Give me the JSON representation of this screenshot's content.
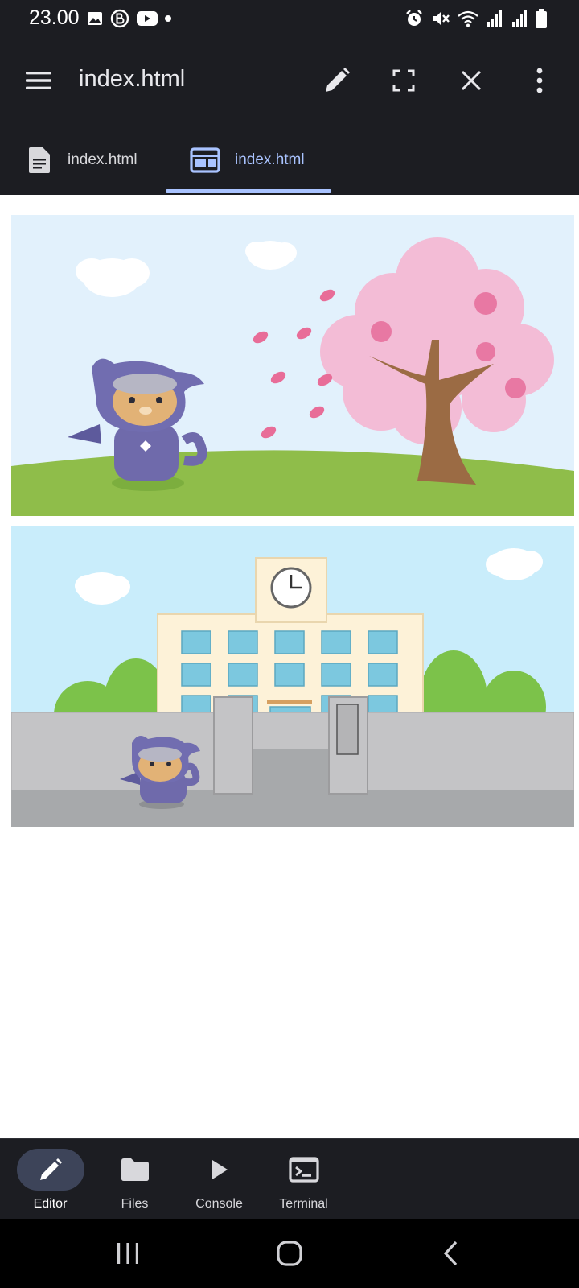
{
  "status_bar": {
    "time": "23.00",
    "left_icons": [
      "image-icon",
      "b-badge-icon",
      "youtube-icon",
      "dot-icon"
    ],
    "right_icons": [
      "alarm-icon",
      "mute-icon",
      "wifi-icon",
      "signal-icon",
      "signal-icon",
      "battery-icon"
    ]
  },
  "app_bar": {
    "title": "index.html",
    "actions": [
      "edit-icon",
      "fullscreen-icon",
      "close-icon",
      "more-vert-icon"
    ]
  },
  "tabs": [
    {
      "label": "index.html",
      "icon": "document-icon",
      "active": false
    },
    {
      "label": "index.html",
      "icon": "preview-icon",
      "active": true
    }
  ],
  "preview": {
    "images": [
      {
        "name": "spring-cherry-blossom-scene"
      },
      {
        "name": "school-gate-scene"
      }
    ]
  },
  "bottom_nav": {
    "items": [
      {
        "label": "Editor",
        "icon": "pencil-icon",
        "active": true
      },
      {
        "label": "Files",
        "icon": "folder-icon",
        "active": false
      },
      {
        "label": "Console",
        "icon": "play-icon",
        "active": false
      },
      {
        "label": "Terminal",
        "icon": "terminal-icon",
        "active": false
      }
    ]
  },
  "system_nav": [
    "recents-icon",
    "home-icon",
    "back-icon"
  ],
  "colors": {
    "app_bar_bg": "#1c1d22",
    "accent": "#a9c3ff",
    "nav_active_pill": "#3d4459"
  }
}
